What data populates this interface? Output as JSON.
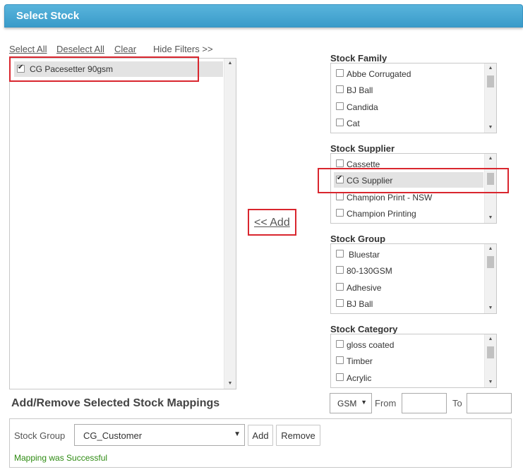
{
  "header": {
    "title": "Select Stock"
  },
  "links": {
    "select_all": "Select All",
    "deselect_all": "Deselect All",
    "clear": "Clear",
    "hide_filters": "Hide Filters >>"
  },
  "results": {
    "items": [
      {
        "label": "CG Pacesetter 90gsm",
        "checked": true
      }
    ]
  },
  "filters": {
    "stock_family": {
      "title": "Stock Family",
      "items": [
        "Abbe Corrugated",
        "BJ Ball",
        "Candida",
        "Cat"
      ]
    },
    "stock_supplier": {
      "title": "Stock Supplier",
      "items": [
        "Cassette",
        "CG Supplier",
        "Champion Print - NSW",
        "Champion Printing"
      ],
      "selected": "CG Supplier"
    },
    "stock_group": {
      "title": "Stock Group",
      "items": [
        "Bluestar",
        "80-130GSM",
        "Adhesive",
        "BJ Ball"
      ]
    },
    "stock_category": {
      "title": "Stock Category",
      "items": [
        "gloss coated",
        "Timber",
        "Acrylic"
      ]
    }
  },
  "add_link": "<< Add",
  "mappings": {
    "heading": "Add/Remove Selected Stock Mappings",
    "unit_select": "GSM",
    "from_label": "From",
    "to_label": "To",
    "from_value": "",
    "to_value": "",
    "stock_group_label": "Stock Group",
    "stock_group_value": "CG_Customer",
    "add_button": "Add",
    "remove_button": "Remove",
    "status": "Mapping was Successful"
  },
  "colors": {
    "header": "#3a9bc9",
    "highlight_box": "#d9262e",
    "success_text": "#2e8b12",
    "selected_row": "#e3e3e3"
  }
}
